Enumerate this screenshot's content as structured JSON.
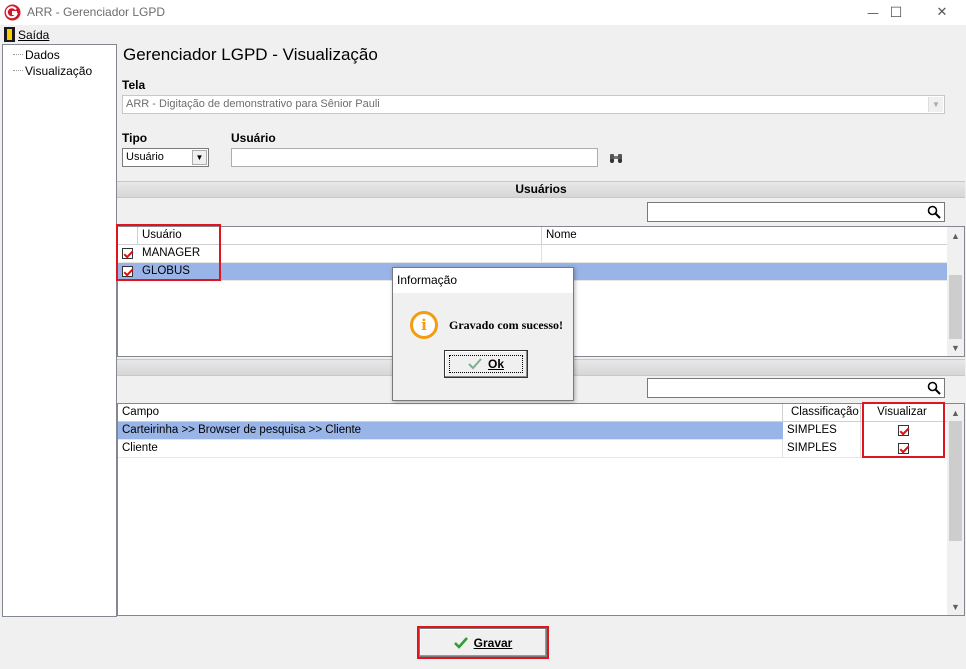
{
  "window": {
    "title": "ARR - Gerenciador LGPD",
    "minimize_symbol": "—",
    "maximize_symbol": "☐",
    "close_symbol": "✕"
  },
  "menu": {
    "saida_label": "Saída"
  },
  "tree": {
    "items": [
      {
        "label": "Dados"
      },
      {
        "label": "Visualização"
      }
    ]
  },
  "page": {
    "title": "Gerenciador LGPD - Visualização",
    "tela_label": "Tela",
    "tela_value": "ARR - Digitação de demonstrativo para Sênior Pauli",
    "tipo_label": "Tipo",
    "tipo_value": "Usuário",
    "usuario_label": "Usuário",
    "usuario_value": ""
  },
  "usuarios_section": {
    "title": "Usuários",
    "search_value": "",
    "columns": [
      "Usuário",
      "Nome"
    ],
    "rows": [
      {
        "usuario": "MANAGER",
        "nome": "",
        "checked": true,
        "selected": false
      },
      {
        "usuario": "GLOBUS",
        "nome": "",
        "checked": true,
        "selected": true
      }
    ]
  },
  "campos_section": {
    "title": "",
    "search_value": "",
    "columns": [
      "Campo",
      "Classificação",
      "Visualizar"
    ],
    "rows": [
      {
        "campo": "Carteirinha >> Browser de pesquisa >> Cliente",
        "classificacao": "SIMPLES",
        "visualizar": true,
        "selected": true
      },
      {
        "campo": "Cliente",
        "classificacao": "SIMPLES",
        "visualizar": true,
        "selected": false
      }
    ]
  },
  "dialog": {
    "title": "Informação",
    "message": "Gravado com sucesso!",
    "ok_label": "Ok"
  },
  "footer": {
    "gravar_label": "Gravar"
  },
  "colors": {
    "selection": "#99b4e7",
    "highlight_border": "#e0141e",
    "info_orange": "#f39c12",
    "check_green": "#2e9e2e"
  }
}
